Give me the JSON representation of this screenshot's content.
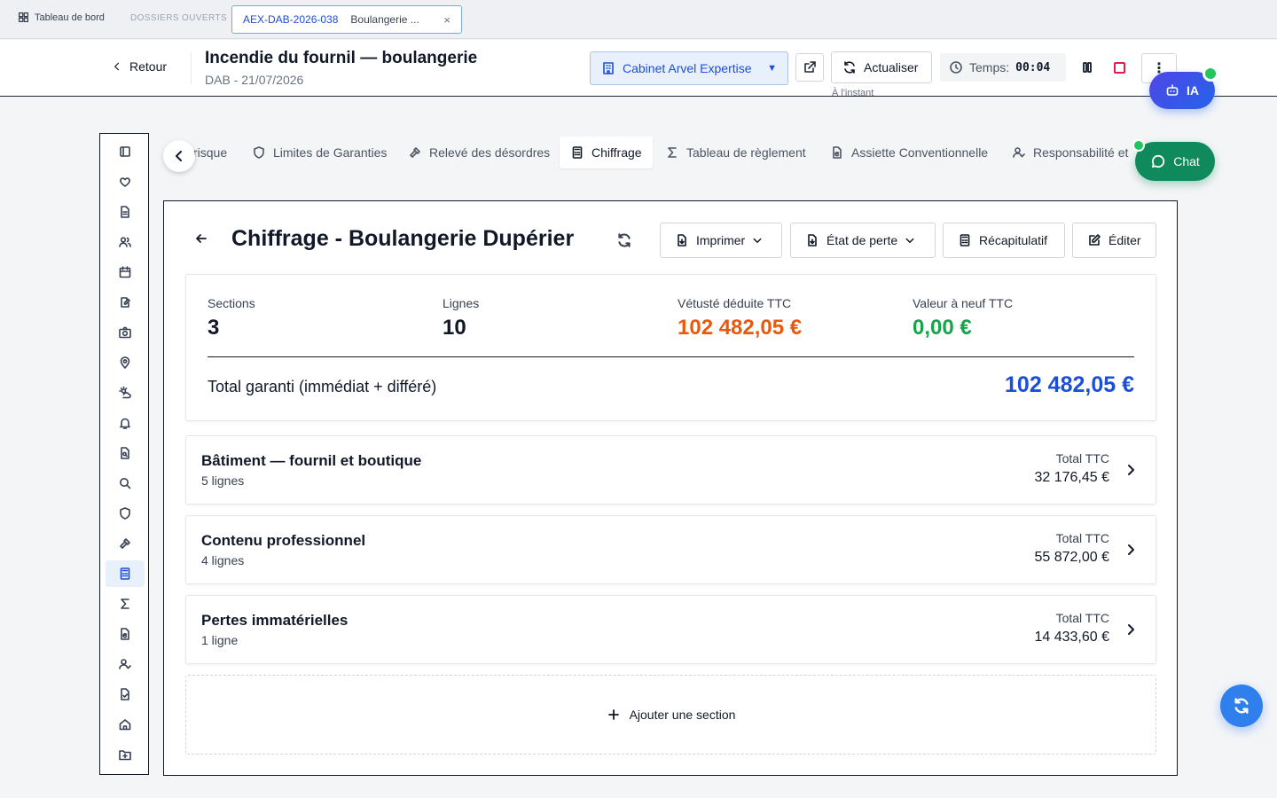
{
  "tabbar": {
    "dashboard_label": "Tableau de bord",
    "open_files_label": "DOSSIERS OUVERTS",
    "file_tab": {
      "code": "AEX-DAB-2026-038",
      "name": "Boulangerie ...",
      "close": "×"
    }
  },
  "header": {
    "back_label": "Retour",
    "title": "Incendie du fournil — boulangerie",
    "subtitle": "DAB - 21/07/2026",
    "cabinet_label": "Cabinet Arvel Expertise",
    "cabinet_caret": "▼",
    "refresh_label": "Actualiser",
    "refresh_sub": "À l'instant",
    "timer_label": "Temps:",
    "timer_value": "00:04",
    "more_label": "⋮"
  },
  "floating": {
    "ia_label": "IA",
    "chat_label": "Chat"
  },
  "rail": {
    "icons": [
      "sidebar-toggle-icon",
      "heart-icon",
      "document-icon",
      "users-icon",
      "calendar-icon",
      "edit-note-icon",
      "camera-icon",
      "map-pin-icon",
      "weather-icon",
      "bell-icon",
      "file-search-icon",
      "search-icon",
      "shield-icon",
      "hammer-icon",
      "calculator-icon",
      "sigma-icon",
      "file-euro-icon",
      "user-check-icon",
      "file-check-icon",
      "home-icon",
      "folder-plus-icon"
    ],
    "active_index": 14
  },
  "section_tabs": {
    "items": [
      {
        "label": "risque",
        "icon": "risk-icon"
      },
      {
        "label": "Limites de Garanties",
        "icon": "shield-icon"
      },
      {
        "label": "Relevé des désordres",
        "icon": "hammer-icon"
      },
      {
        "label": "Chiffrage",
        "icon": "calculator-icon"
      },
      {
        "label": "Tableau de règlement",
        "icon": "sigma-icon"
      },
      {
        "label": "Assiette Conventionnelle",
        "icon": "file-euro-icon"
      },
      {
        "label": "Responsabilité et",
        "icon": "user-check-icon"
      }
    ],
    "active": "Chiffrage"
  },
  "main": {
    "title": "Chiffrage - Boulangerie Dupérier",
    "buttons": {
      "print": "Imprimer",
      "loss_state": "État de perte",
      "summary": "Récapitulatif",
      "edit": "Éditer"
    },
    "stats": {
      "sections_label": "Sections",
      "sections_value": "3",
      "lines_label": "Lignes",
      "lines_value": "10",
      "vetuste_label": "Vétusté déduite TTC",
      "vetuste_value": "102 482,05 €",
      "neuf_label": "Valeur à neuf TTC",
      "neuf_value": "0,00 €",
      "total_label": "Total garanti (immédiat + différé)",
      "total_value": "102 482,05 €"
    },
    "sections": [
      {
        "name": "Bâtiment — fournil et boutique",
        "count": "5 lignes",
        "total_label": "Total TTC",
        "total_value": "32 176,45 €"
      },
      {
        "name": "Contenu professionnel",
        "count": "4 lignes",
        "total_label": "Total TTC",
        "total_value": "55 872,00 €"
      },
      {
        "name": "Pertes immatérielles",
        "count": "1 ligne",
        "total_label": "Total TTC",
        "total_value": "14 433,60 €"
      }
    ],
    "add_section_label": "Ajouter une section"
  },
  "colors": {
    "accent": "#1d4ed8",
    "orange": "#ea580c",
    "green": "#16a34a",
    "chat": "#0f8a5c",
    "stop": "#e11d48"
  }
}
